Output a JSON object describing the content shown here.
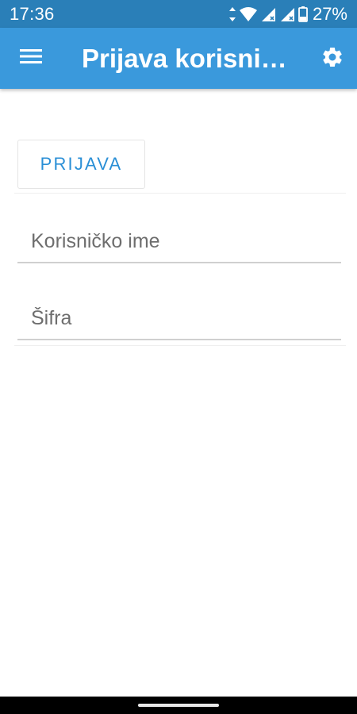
{
  "status_bar": {
    "time": "17:36",
    "battery_percent": "27%",
    "background_color": "#2a7fb8"
  },
  "app_bar": {
    "title": "Prijava korisni…",
    "background_color": "#3a99dc",
    "menu_icon": "hamburger-menu-icon",
    "settings_icon": "gear-icon"
  },
  "login_form": {
    "submit_label": "PRIJAVA",
    "username": {
      "placeholder": "Korisničko ime",
      "value": ""
    },
    "password": {
      "placeholder": "Šifra",
      "value": ""
    },
    "accent_color": "#2a8fd6"
  }
}
